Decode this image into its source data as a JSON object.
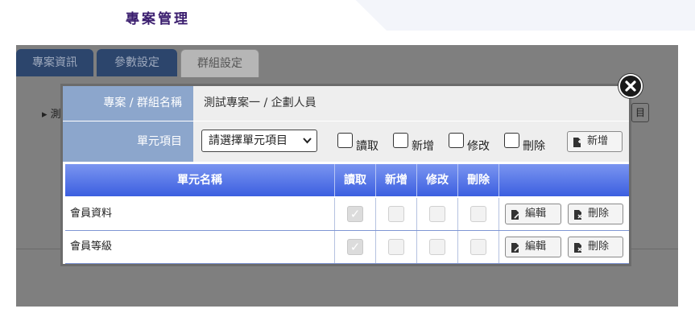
{
  "header": {
    "title": "專案管理"
  },
  "tabs": [
    {
      "label": "專案資訊"
    },
    {
      "label": "參數設定"
    },
    {
      "label": "群組設定"
    }
  ],
  "background": {
    "row_label": "▸ 測",
    "button_fragment": "目"
  },
  "modal": {
    "project_group_label": "專案 / 群組名稱",
    "project_group_value": "測試專案一 / 企劃人員",
    "unit_item_label": "單元項目",
    "unit_select": {
      "selected": "請選擇單元項目",
      "icon": "chevron-down-icon"
    },
    "permissions": [
      {
        "label": "讀取",
        "checked": false
      },
      {
        "label": "新增",
        "checked": false
      },
      {
        "label": "修改",
        "checked": false
      },
      {
        "label": "刪除",
        "checked": false
      }
    ],
    "add_button_label": "新增",
    "close_icon": "close-circle-icon"
  },
  "table": {
    "headers": [
      "單元名稱",
      "讀取",
      "新增",
      "修改",
      "刪除",
      ""
    ],
    "rows": [
      {
        "name": "會員資料",
        "read": true,
        "create": false,
        "update": false,
        "delete": false,
        "edit_label": "編輯",
        "delete_label": "刪除"
      },
      {
        "name": "會員等級",
        "read": true,
        "create": false,
        "update": false,
        "delete": false,
        "edit_label": "編輯",
        "delete_label": "刪除"
      }
    ]
  },
  "colors": {
    "title": "#3a1d6e",
    "tab_active_bg": "#2c456c",
    "label_bg": "#8ca6cc",
    "table_header": "#4a6ae6",
    "overlay": "#7f7f7f"
  }
}
